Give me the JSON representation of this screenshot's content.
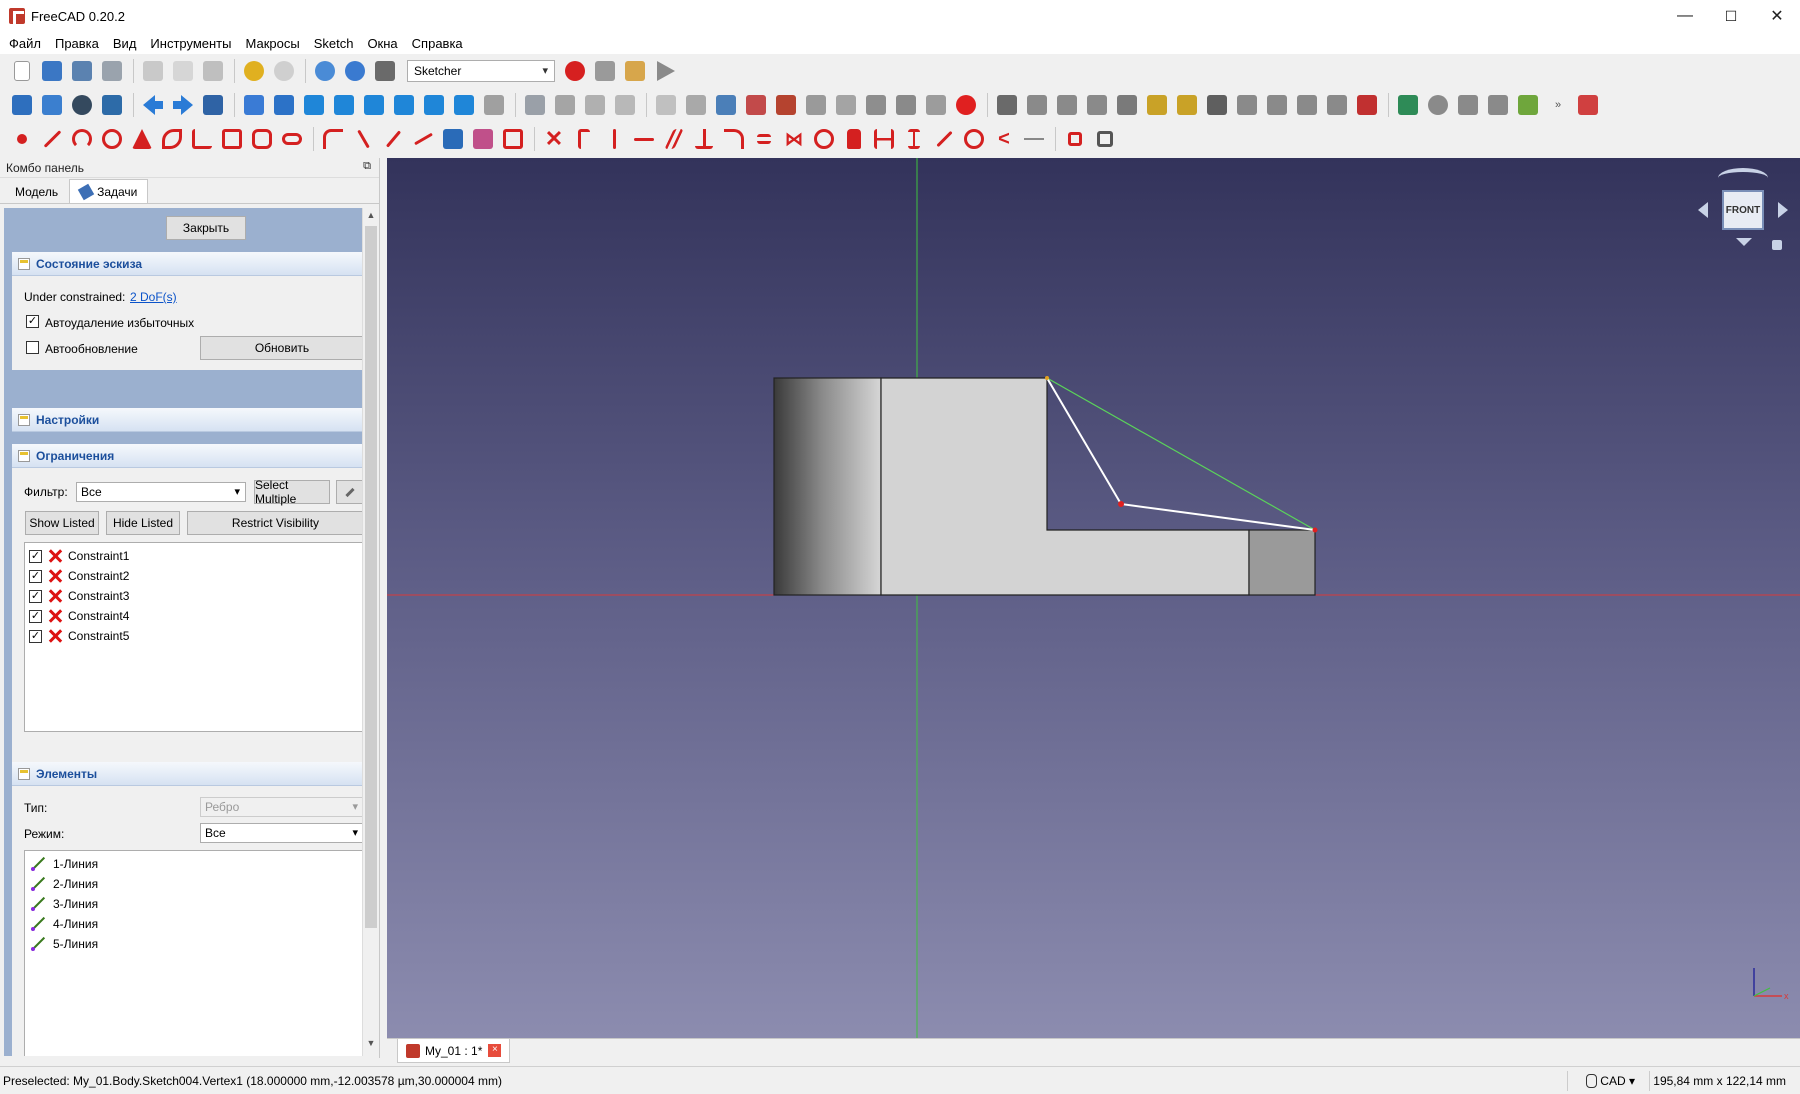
{
  "window": {
    "title": "FreeCAD 0.20.2",
    "min": "—",
    "max": "☐",
    "close": "✕"
  },
  "menu": [
    "Файл",
    "Правка",
    "Вид",
    "Инструменты",
    "Макросы",
    "Sketch",
    "Окна",
    "Справка"
  ],
  "workbench": {
    "selected": "Sketcher"
  },
  "combo_panel": {
    "title": "Комбо панель",
    "tabs": [
      {
        "label": "Модель"
      },
      {
        "label": "Задачи"
      }
    ],
    "close_button": "Закрыть",
    "state": {
      "title": "Состояние эскиза",
      "under_constrained_label": "Under constrained:",
      "dof_link": "2 DoF(s)",
      "auto_remove_label": "Автоудаление избыточных",
      "auto_remove_checked": true,
      "auto_update_label": "Автообновление",
      "auto_update_checked": false,
      "update_button": "Обновить"
    },
    "settings": {
      "title": "Настройки"
    },
    "constraints": {
      "title": "Ограничения",
      "filter_label": "Фильтр:",
      "filter_value": "Все",
      "select_multiple": "Select Multiple",
      "show_listed": "Show Listed",
      "hide_listed": "Hide Listed",
      "restrict_visibility": "Restrict Visibility",
      "items": [
        "Constraint1",
        "Constraint2",
        "Constraint3",
        "Constraint4",
        "Constraint5"
      ]
    },
    "elements": {
      "title": "Элементы",
      "type_label": "Тип:",
      "type_value": "Ребро",
      "mode_label": "Режим:",
      "mode_value": "Все",
      "items": [
        "1-Линия",
        "2-Линия",
        "3-Линия",
        "4-Линия",
        "5-Линия"
      ]
    }
  },
  "viewport": {
    "nav_cube_face": "FRONT",
    "axis_colors": {
      "x": "#d83a3a",
      "y": "#3ec23e"
    },
    "sketch_color": "#ffffff",
    "construction_color": "#5ad35a"
  },
  "doc_tab": {
    "label": "My_01 : 1*"
  },
  "status": {
    "preselected": "Preselected: My_01.Body.Sketch004.Vertex1 (18.000000 mm,-12.003578 µm,30.000004 mm)",
    "nav_style": "CAD",
    "dimensions": "195,84 mm x 122,14 mm"
  }
}
